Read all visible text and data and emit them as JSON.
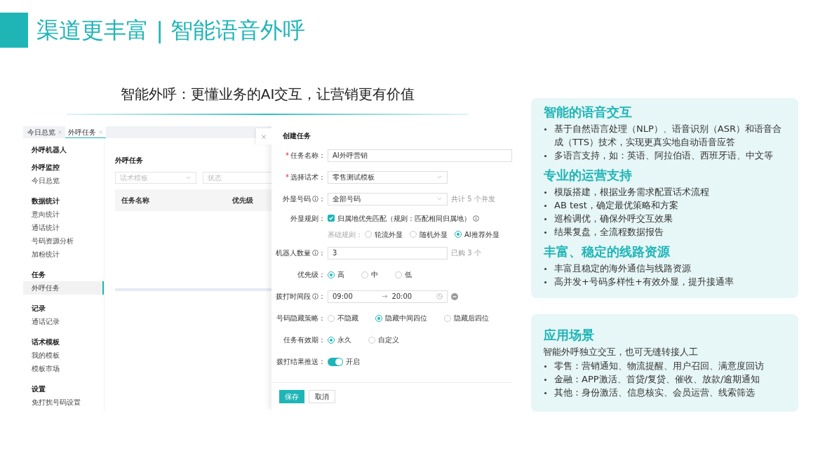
{
  "slide": {
    "title": "渠道更丰富 | 智能语音外呼",
    "subtitle": "智能外呼：更懂业务的AI交互，让营销更有价值"
  },
  "app": {
    "tabs": [
      {
        "label": "今日总览",
        "selected": false
      },
      {
        "label": "外呼任务",
        "selected": true
      }
    ],
    "sidebar": {
      "title": "外呼机器人",
      "groups": [
        {
          "heading": "外呼监控",
          "items": [
            {
              "label": "今日总览",
              "selected": false
            }
          ]
        },
        {
          "heading": "数据统计",
          "items": [
            {
              "label": "意向统计",
              "selected": false
            },
            {
              "label": "通话统计",
              "selected": false
            },
            {
              "label": "号码资源分析",
              "selected": false
            },
            {
              "label": "加粉统计",
              "selected": false
            }
          ]
        },
        {
          "heading": "任务",
          "items": [
            {
              "label": "外呼任务",
              "selected": true
            }
          ]
        },
        {
          "heading": "记录",
          "items": [
            {
              "label": "通话记录",
              "selected": false
            }
          ]
        },
        {
          "heading": "话术模板",
          "items": [
            {
              "label": "我的模板",
              "selected": false
            },
            {
              "label": "模板市场",
              "selected": false
            }
          ]
        },
        {
          "heading": "设置",
          "items": [
            {
              "label": "免打扰号码设置",
              "selected": false
            }
          ]
        }
      ]
    },
    "main": {
      "title": "外呼任务",
      "filters": [
        {
          "kind": "select",
          "placeholder": "话术模板"
        },
        {
          "kind": "input",
          "placeholder": "状态"
        }
      ],
      "table": {
        "columns": [
          "任务名称",
          "优先级"
        ]
      }
    },
    "drawer": {
      "title": "创建任务",
      "fields": [
        {
          "kind": "input",
          "label": "任务名称：",
          "required_mark": "*",
          "value": "AI外呼营销"
        },
        {
          "kind": "select",
          "label": "选择话术：",
          "required_mark": "*",
          "value": "零售测试模板"
        },
        {
          "kind": "select",
          "label": "外显号码",
          "info": true,
          "colon": "：",
          "value": "全部号码",
          "note": "共计 5 个并发"
        },
        {
          "kind": "checkbox",
          "label": "外显规则：",
          "checked": true,
          "text": "归属地优先匹配（规则：匹配相同归属地）",
          "trailing_info": true
        },
        {
          "kind": "subradio",
          "label": "基础规则：",
          "options": [
            {
              "label": "轮流外显",
              "selected": false
            },
            {
              "label": "随机外显",
              "selected": false
            },
            {
              "label": "AI推荐外显",
              "selected": true
            }
          ]
        },
        {
          "kind": "input",
          "label": "机器人数量",
          "info": true,
          "colon": "：",
          "value": "3",
          "note": "已购 3 个"
        },
        {
          "kind": "radio",
          "label": "优先级：",
          "options": [
            {
              "label": "高",
              "selected": true
            },
            {
              "label": "中",
              "selected": false
            },
            {
              "label": "低",
              "selected": false
            }
          ]
        },
        {
          "kind": "timerange",
          "label": "拨打时间段",
          "info": true,
          "colon": "：",
          "start": "09:00",
          "separator": "→",
          "end": "20:00"
        },
        {
          "kind": "radio",
          "label": "号码隐藏策略：",
          "options": [
            {
              "label": "不隐藏",
              "selected": false
            },
            {
              "label": "隐藏中间四位",
              "selected": true
            },
            {
              "label": "隐藏后四位",
              "selected": false
            }
          ]
        },
        {
          "kind": "radio",
          "label": "任务有效期：",
          "options": [
            {
              "label": "永久",
              "selected": true
            },
            {
              "label": "自定义",
              "selected": false
            }
          ]
        },
        {
          "kind": "switch",
          "label": "拨打结果推送：",
          "on": true,
          "text": "开启"
        }
      ],
      "buttons": [
        {
          "kind": "primary",
          "label": "保存"
        },
        {
          "kind": "default",
          "label": "取消"
        }
      ]
    }
  },
  "cards": [
    {
      "sections": [
        {
          "heading": "智能的语音交互",
          "bullets": [
            "基于自然语言处理（NLP）、语音识别（ASR）和语音合成（TTS）技术，实现更真实地自动语音应答",
            "多语言支持，如：英语、阿拉伯语、西班牙语、中文等"
          ]
        },
        {
          "heading": "专业的运营支持",
          "bullets": [
            "模版搭建，根据业务需求配置话术流程",
            "AB test，确定最优策略和方案",
            "巡检调优，确保外呼交互效果",
            "结果复盘，全流程数据报告"
          ]
        },
        {
          "heading": "丰富、稳定的线路资源",
          "bullets": [
            "丰富且稳定的海外通信与线路资源",
            "高并发+号码多样性+有效外显，提升接通率"
          ]
        }
      ]
    },
    {
      "sections": [
        {
          "heading": "应用场景",
          "intro": "智能外呼独立交互，也可无缝转接人工",
          "bullets": [
            "零售：营销通知、物流提醒、用户召回、满意度回访",
            "金融：APP激活、首贷/复贷、催收、放款/逾期通知",
            "其他：身份激活、信息核实、会员运营、线索筛选"
          ]
        }
      ]
    }
  ]
}
